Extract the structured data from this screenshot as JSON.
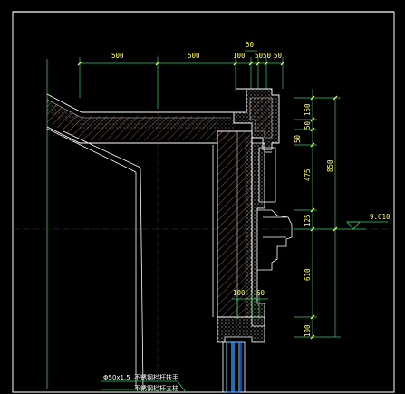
{
  "drawing": {
    "background": "#000000",
    "colors": {
      "frame": "#ffffff",
      "dimension": "#ffff66",
      "extension": "#33cc66",
      "wall_outline": "#ffffff",
      "hatch": "#cc9966",
      "insulation": "#dddddd",
      "glass": "#3399ff",
      "leader": "#33cc66",
      "axis": "#33aacc"
    },
    "top_dims": [
      "500",
      "500",
      "100",
      "50",
      "50",
      "50"
    ],
    "top_dim_extra": "50",
    "right_dims_inner": [
      "150",
      "50",
      "50",
      "475",
      "125",
      "610",
      "100"
    ],
    "right_dim_total": "850",
    "lower_dims": [
      "100",
      "60"
    ],
    "elevation": "9.610",
    "notes": [
      "Φ50x1.5",
      "不锈钢栏杆扶手",
      "不锈钢栏杆立柱"
    ]
  }
}
